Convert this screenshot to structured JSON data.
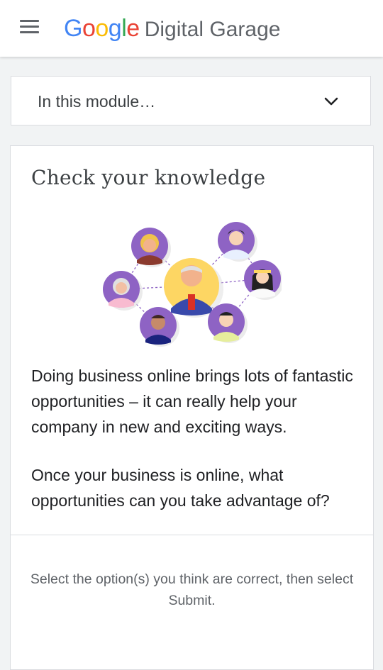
{
  "header": {
    "menu_icon": "hamburger-menu-icon",
    "brand_letters": [
      {
        "ch": "G",
        "color": "#4285F4"
      },
      {
        "ch": "o",
        "color": "#EA4335"
      },
      {
        "ch": "o",
        "color": "#FBBC05"
      },
      {
        "ch": "g",
        "color": "#4285F4"
      },
      {
        "ch": "l",
        "color": "#34A853"
      },
      {
        "ch": "e",
        "color": "#EA4335"
      }
    ],
    "brand_suffix": "Digital Garage"
  },
  "module_bar": {
    "label": "In this module…",
    "icon": "chevron-down-icon"
  },
  "card": {
    "title": "Check your knowledge",
    "paragraph_1": "Doing business online brings lots of fantastic opportunities – it can really help your company in new and exciting ways.",
    "paragraph_2": "Once your business is online, what opportunities can you take advantage of?",
    "instruction": "Select the option(s) you think are correct, then select Submit."
  },
  "colors": {
    "background": "#f1f3f4",
    "surface": "#ffffff",
    "border": "#dadce0",
    "text_primary": "#202124",
    "text_secondary": "#5f6368",
    "icon_gray": "#5f6368",
    "avatar_purple": "#8e63c4",
    "avatar_yellow": "#fdd663"
  }
}
